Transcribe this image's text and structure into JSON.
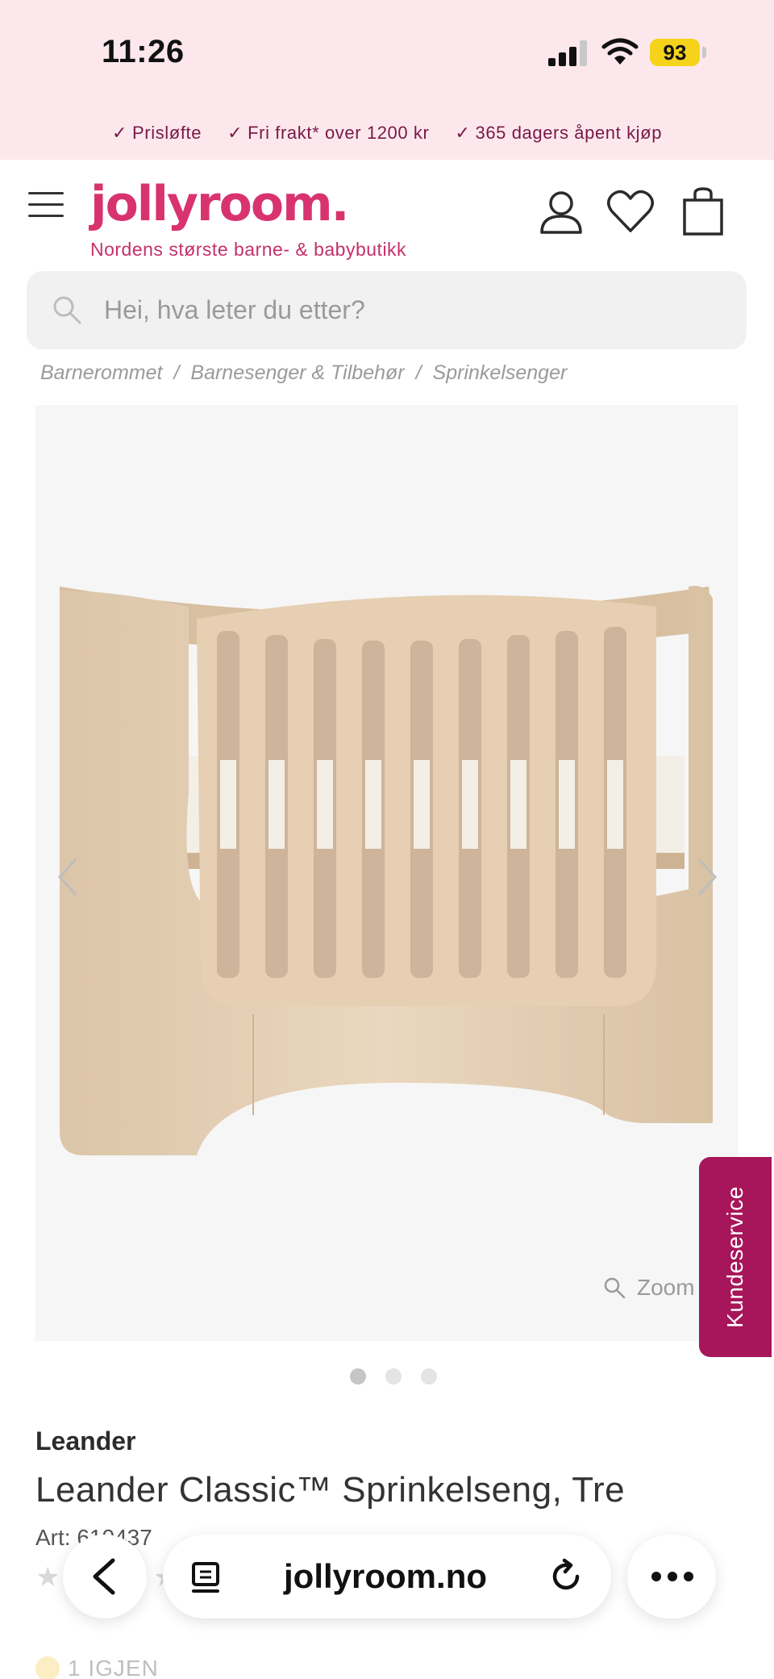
{
  "status_bar": {
    "time": "11:26",
    "battery": "93"
  },
  "usp": [
    {
      "label": "Prisløfte"
    },
    {
      "label": "Fri frakt* over 1200 kr"
    },
    {
      "label": "365 dagers åpent kjøp"
    }
  ],
  "header": {
    "logo": "jollyroom.",
    "tagline": "Nordens største barne- & babybutikk"
  },
  "search": {
    "placeholder": "Hei, hva leter du etter?"
  },
  "breadcrumb": [
    {
      "label": "Barnerommet"
    },
    {
      "label": "Barnesenger & Tilbehør"
    },
    {
      "label": "Sprinkelsenger"
    }
  ],
  "gallery": {
    "zoom_label": "Zoom",
    "image_count": 3,
    "active_index": 0
  },
  "kundeservice": "Kundeservice",
  "product": {
    "brand": "Leander",
    "title": "Leander Classic™ Sprinkelseng, Tre",
    "art_no": "Art: 610437",
    "stock": "1 IGJEN"
  },
  "browser": {
    "url": "jollyroom.no"
  },
  "colors": {
    "brand_pink": "#d8336f",
    "kundeservice_bg": "#a7155a",
    "usp_bg": "#fce8ec"
  }
}
